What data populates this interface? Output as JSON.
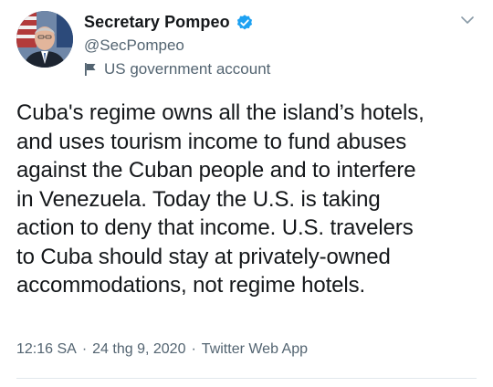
{
  "tweet": {
    "display_name": "Secretary Pompeo",
    "handle": "@SecPompeo",
    "account_label": "US government account",
    "text": "Cuba's regime owns all the island’s hotels,\nand uses tourism income to fund abuses\nagainst the Cuban people and to interfere\nin Venezuela. Today the U.S. is taking\naction to deny that income. U.S. travelers\nto Cuba should stay at privately-owned\naccommodations, not regime hotels.",
    "time": "12:16 SA",
    "date": "24 thg 9, 2020",
    "source": "Twitter Web App",
    "separator": "·"
  },
  "icons": {
    "verified": "verified-badge-icon",
    "government": "flag-icon",
    "menu": "chevron-down-icon"
  },
  "colors": {
    "verified_blue": "#1da1f2",
    "secondary_text": "#536471",
    "primary_text": "#14171a"
  }
}
